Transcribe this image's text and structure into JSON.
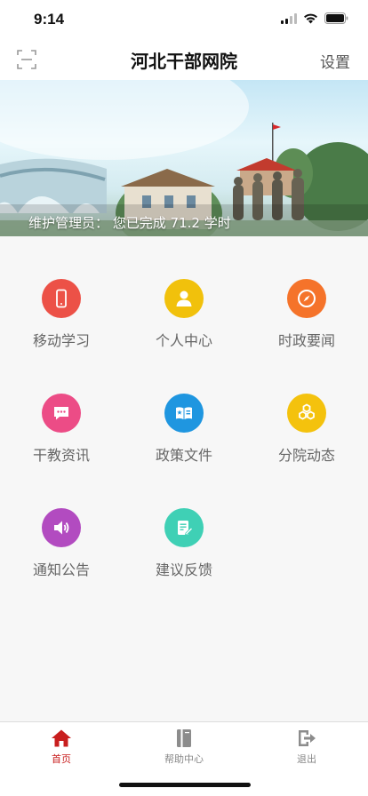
{
  "status_bar": {
    "time": "9:14"
  },
  "nav": {
    "title": "河北干部网院",
    "settings_label": "设置",
    "scan_icon": "scan-icon"
  },
  "banner": {
    "caption": "维护管理员： 您已完成 71.2 学时"
  },
  "menu": [
    {
      "label": "移动学习",
      "icon": "mobile-phone-icon",
      "color": "#ec5147"
    },
    {
      "label": "个人中心",
      "icon": "user-icon",
      "color": "#f1c10c"
    },
    {
      "label": "时政要闻",
      "icon": "compass-icon",
      "color": "#f5732a"
    },
    {
      "label": "干教资讯",
      "icon": "chat-bubble-icon",
      "color": "#ec4c86"
    },
    {
      "label": "政策文件",
      "icon": "open-book-icon",
      "color": "#1f96e0"
    },
    {
      "label": "分院动态",
      "icon": "hexagons-icon",
      "color": "#f4c20d"
    },
    {
      "label": "通知公告",
      "icon": "speaker-icon",
      "color": "#b24bc0"
    },
    {
      "label": "建议反馈",
      "icon": "edit-note-icon",
      "color": "#3fd0b5"
    }
  ],
  "tabs": [
    {
      "label": "首页",
      "icon": "home-icon",
      "active": true,
      "color": "#c81e1e"
    },
    {
      "label": "帮助中心",
      "icon": "book-icon",
      "active": false,
      "color": "#888888"
    },
    {
      "label": "退出",
      "icon": "logout-icon",
      "active": false,
      "color": "#888888"
    }
  ]
}
